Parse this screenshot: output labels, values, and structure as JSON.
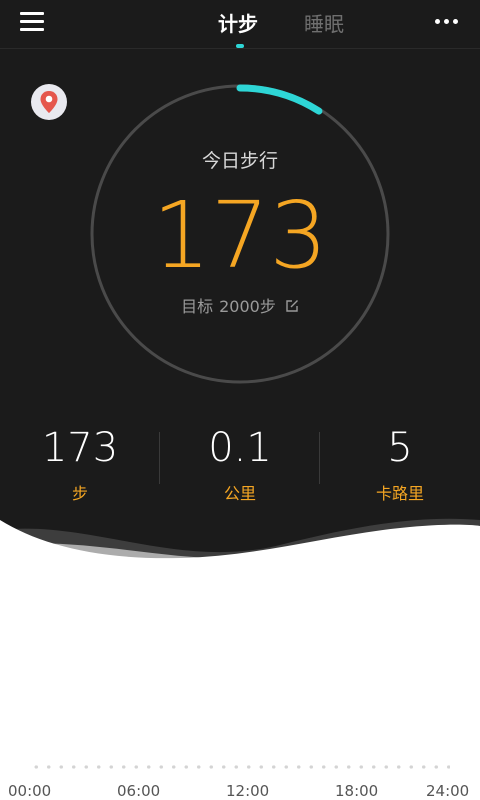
{
  "header": {
    "tabs": [
      {
        "label": "计步",
        "active": true
      },
      {
        "label": "睡眠",
        "active": false
      }
    ]
  },
  "icons": {
    "menu": "hamburger-menu-icon",
    "more": "more-horizontal-icon",
    "location": "location-pin-icon",
    "edit": "edit-icon"
  },
  "progress": {
    "label": "今日步行",
    "steps": "173",
    "goal_prefix": "目标",
    "goal_value": "2000步",
    "fraction": 0.0865
  },
  "stats": [
    {
      "value": "173",
      "unit": "步"
    },
    {
      "value": "0.1",
      "unit": "公里"
    },
    {
      "value": "5",
      "unit": "卡路里"
    }
  ],
  "timeline": {
    "ticks": [
      "00:00",
      "06:00",
      "12:00",
      "18:00",
      "24:00"
    ]
  },
  "colors": {
    "background_dark": "#1b1b1b",
    "accent_orange": "#f5a623",
    "accent_cyan": "#2ed6d6"
  }
}
